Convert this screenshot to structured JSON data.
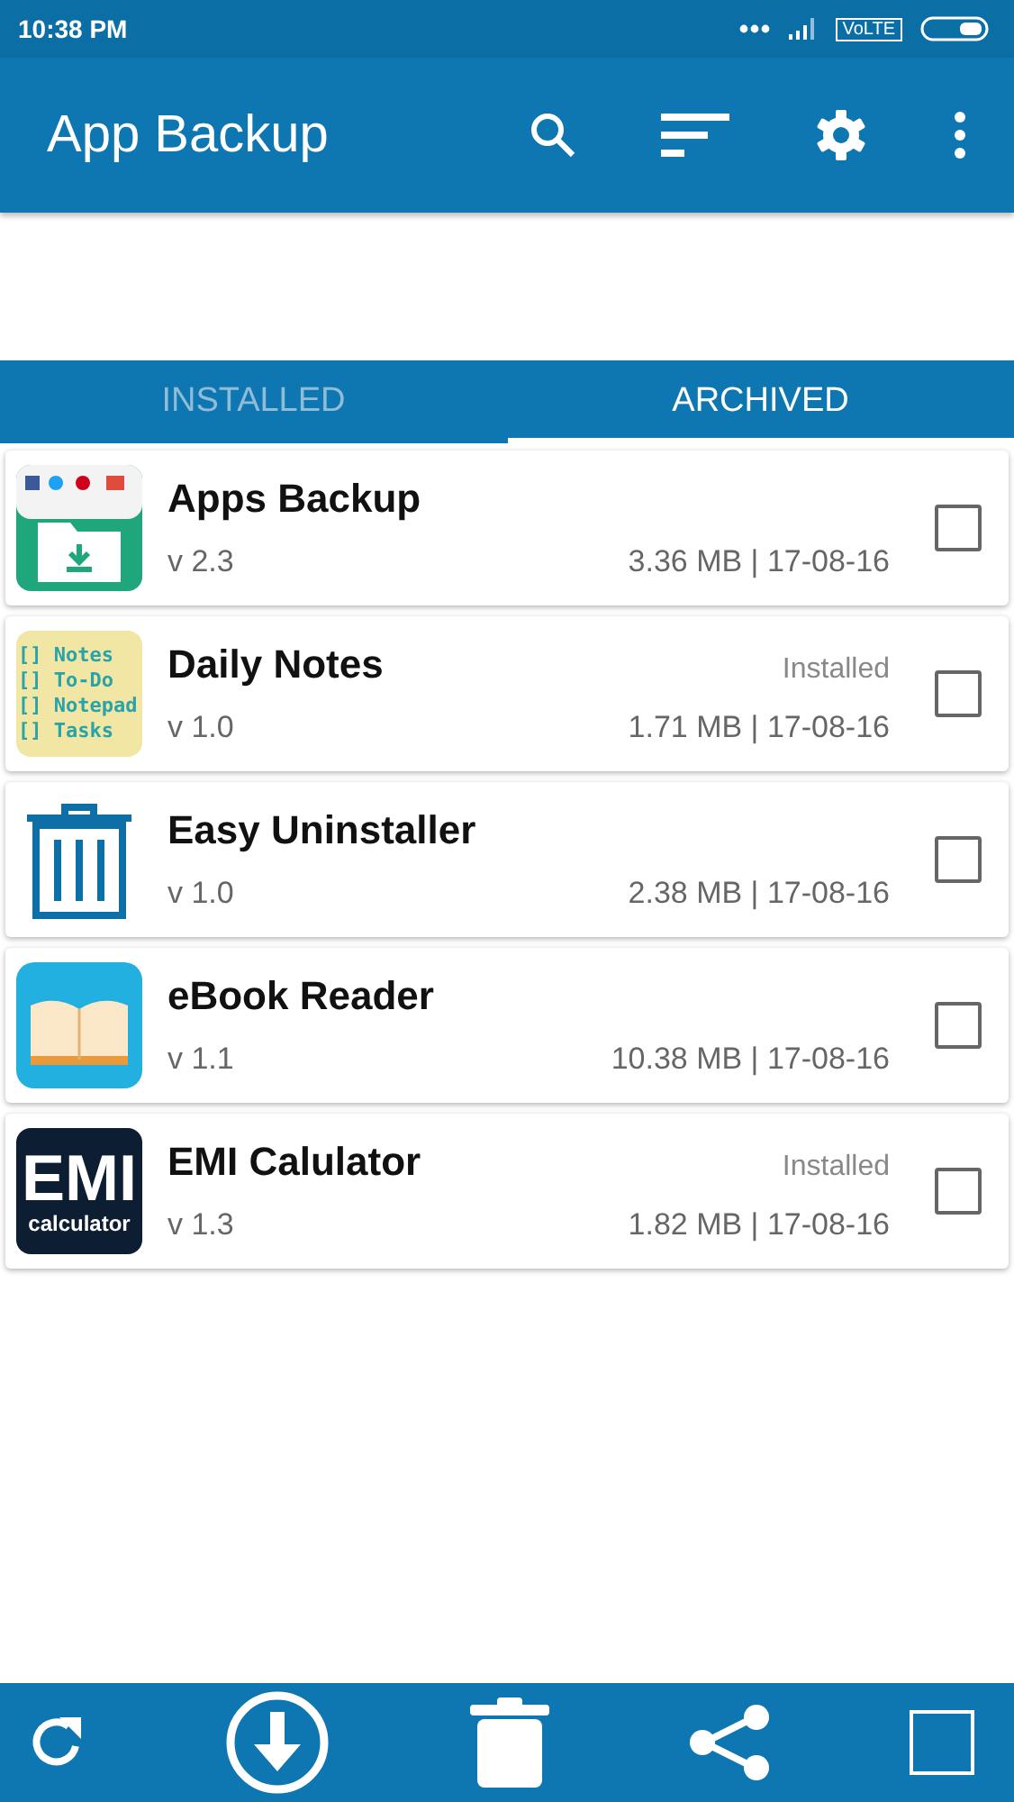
{
  "status_bar": {
    "time": "10:38 PM",
    "network": "VoLTE"
  },
  "app_bar": {
    "title": "App Backup"
  },
  "tabs": [
    {
      "label": "INSTALLED",
      "selected": false
    },
    {
      "label": "ARCHIVED",
      "selected": true
    }
  ],
  "apps": [
    {
      "name": "Apps Backup",
      "version": "v 2.3",
      "details": "3.36 MB | 17-08-16",
      "checked": false,
      "icon": {
        "kind": "backup"
      }
    },
    {
      "name": "Daily Notes",
      "version": "v 1.0",
      "status": "Installed",
      "details": "1.71 MB | 17-08-16",
      "checked": false,
      "icon": {
        "kind": "notes",
        "lines": [
          "[] Notes",
          "[] To-Do",
          "[] Notepad",
          "[] Tasks"
        ]
      }
    },
    {
      "name": "Easy Uninstaller",
      "version": "v 1.0",
      "details": "2.38 MB | 17-08-16",
      "checked": false,
      "icon": {
        "kind": "trash"
      }
    },
    {
      "name": "eBook Reader",
      "version": "v 1.1",
      "details": "10.38 MB | 17-08-16",
      "checked": false,
      "icon": {
        "kind": "book"
      }
    },
    {
      "name": "EMI Calulator",
      "version": "v 1.3",
      "status": "Installed",
      "details": "1.82 MB | 17-08-16",
      "checked": false,
      "icon": {
        "kind": "emi",
        "lines": [
          "EMI",
          "calculator"
        ]
      }
    }
  ],
  "bottom_bar": {
    "select_all_checked": false
  }
}
